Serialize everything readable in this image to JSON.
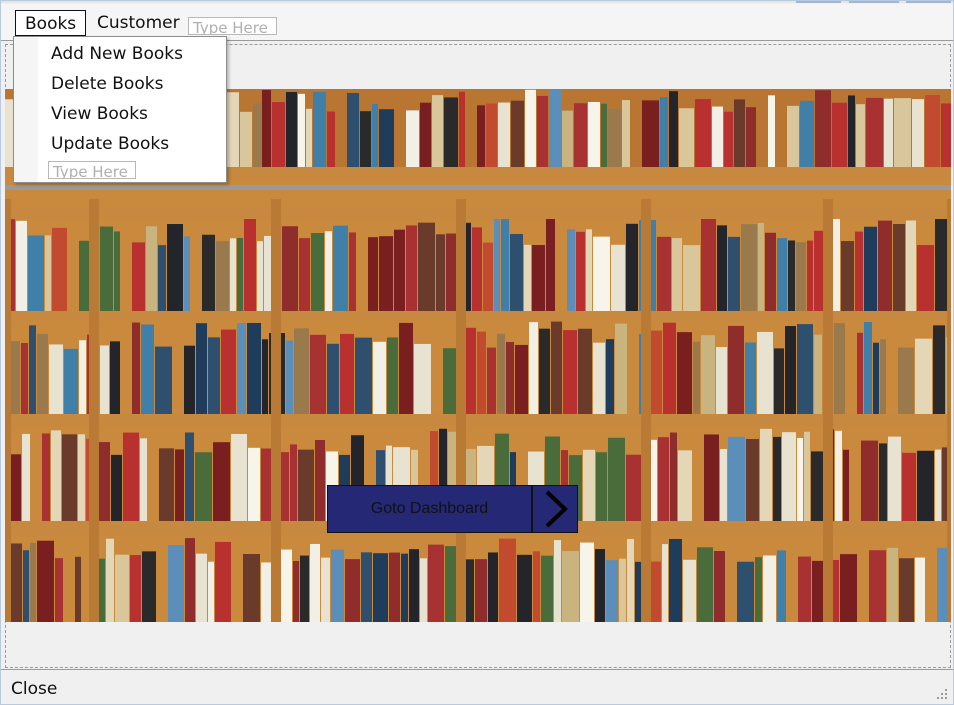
{
  "menubar": {
    "items": [
      {
        "label": "Books"
      },
      {
        "label": "Customer"
      }
    ],
    "type_here": "Type Here"
  },
  "books_menu": {
    "items": [
      {
        "label": "Add New Books"
      },
      {
        "label": "Delete Books"
      },
      {
        "label": "View Books"
      },
      {
        "label": "Update Books"
      }
    ],
    "type_here": "Type Here"
  },
  "main": {
    "background_image": "bookshelf-photo",
    "goto_button_label": "Goto Dashboard",
    "goto_icon": "chevron-right-icon",
    "button_color": "#242875"
  },
  "statusbar": {
    "close_label": "Close"
  }
}
